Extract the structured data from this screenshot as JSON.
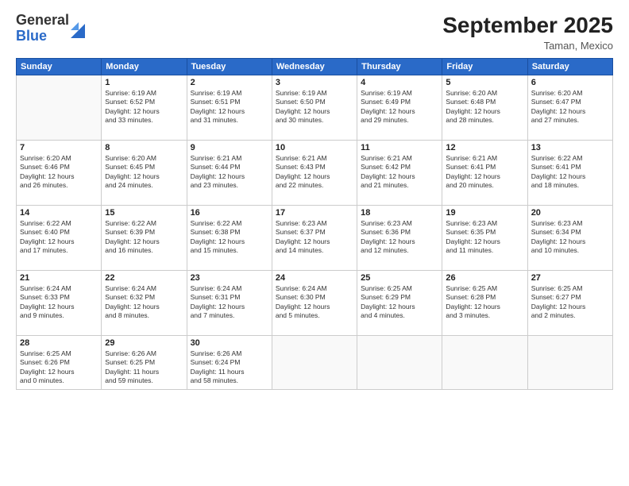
{
  "logo": {
    "general": "General",
    "blue": "Blue"
  },
  "title": "September 2025",
  "location": "Taman, Mexico",
  "days_header": [
    "Sunday",
    "Monday",
    "Tuesday",
    "Wednesday",
    "Thursday",
    "Friday",
    "Saturday"
  ],
  "weeks": [
    [
      {
        "num": "",
        "info": ""
      },
      {
        "num": "1",
        "info": "Sunrise: 6:19 AM\nSunset: 6:52 PM\nDaylight: 12 hours\nand 33 minutes."
      },
      {
        "num": "2",
        "info": "Sunrise: 6:19 AM\nSunset: 6:51 PM\nDaylight: 12 hours\nand 31 minutes."
      },
      {
        "num": "3",
        "info": "Sunrise: 6:19 AM\nSunset: 6:50 PM\nDaylight: 12 hours\nand 30 minutes."
      },
      {
        "num": "4",
        "info": "Sunrise: 6:19 AM\nSunset: 6:49 PM\nDaylight: 12 hours\nand 29 minutes."
      },
      {
        "num": "5",
        "info": "Sunrise: 6:20 AM\nSunset: 6:48 PM\nDaylight: 12 hours\nand 28 minutes."
      },
      {
        "num": "6",
        "info": "Sunrise: 6:20 AM\nSunset: 6:47 PM\nDaylight: 12 hours\nand 27 minutes."
      }
    ],
    [
      {
        "num": "7",
        "info": "Sunrise: 6:20 AM\nSunset: 6:46 PM\nDaylight: 12 hours\nand 26 minutes."
      },
      {
        "num": "8",
        "info": "Sunrise: 6:20 AM\nSunset: 6:45 PM\nDaylight: 12 hours\nand 24 minutes."
      },
      {
        "num": "9",
        "info": "Sunrise: 6:21 AM\nSunset: 6:44 PM\nDaylight: 12 hours\nand 23 minutes."
      },
      {
        "num": "10",
        "info": "Sunrise: 6:21 AM\nSunset: 6:43 PM\nDaylight: 12 hours\nand 22 minutes."
      },
      {
        "num": "11",
        "info": "Sunrise: 6:21 AM\nSunset: 6:42 PM\nDaylight: 12 hours\nand 21 minutes."
      },
      {
        "num": "12",
        "info": "Sunrise: 6:21 AM\nSunset: 6:41 PM\nDaylight: 12 hours\nand 20 minutes."
      },
      {
        "num": "13",
        "info": "Sunrise: 6:22 AM\nSunset: 6:41 PM\nDaylight: 12 hours\nand 18 minutes."
      }
    ],
    [
      {
        "num": "14",
        "info": "Sunrise: 6:22 AM\nSunset: 6:40 PM\nDaylight: 12 hours\nand 17 minutes."
      },
      {
        "num": "15",
        "info": "Sunrise: 6:22 AM\nSunset: 6:39 PM\nDaylight: 12 hours\nand 16 minutes."
      },
      {
        "num": "16",
        "info": "Sunrise: 6:22 AM\nSunset: 6:38 PM\nDaylight: 12 hours\nand 15 minutes."
      },
      {
        "num": "17",
        "info": "Sunrise: 6:23 AM\nSunset: 6:37 PM\nDaylight: 12 hours\nand 14 minutes."
      },
      {
        "num": "18",
        "info": "Sunrise: 6:23 AM\nSunset: 6:36 PM\nDaylight: 12 hours\nand 12 minutes."
      },
      {
        "num": "19",
        "info": "Sunrise: 6:23 AM\nSunset: 6:35 PM\nDaylight: 12 hours\nand 11 minutes."
      },
      {
        "num": "20",
        "info": "Sunrise: 6:23 AM\nSunset: 6:34 PM\nDaylight: 12 hours\nand 10 minutes."
      }
    ],
    [
      {
        "num": "21",
        "info": "Sunrise: 6:24 AM\nSunset: 6:33 PM\nDaylight: 12 hours\nand 9 minutes."
      },
      {
        "num": "22",
        "info": "Sunrise: 6:24 AM\nSunset: 6:32 PM\nDaylight: 12 hours\nand 8 minutes."
      },
      {
        "num": "23",
        "info": "Sunrise: 6:24 AM\nSunset: 6:31 PM\nDaylight: 12 hours\nand 7 minutes."
      },
      {
        "num": "24",
        "info": "Sunrise: 6:24 AM\nSunset: 6:30 PM\nDaylight: 12 hours\nand 5 minutes."
      },
      {
        "num": "25",
        "info": "Sunrise: 6:25 AM\nSunset: 6:29 PM\nDaylight: 12 hours\nand 4 minutes."
      },
      {
        "num": "26",
        "info": "Sunrise: 6:25 AM\nSunset: 6:28 PM\nDaylight: 12 hours\nand 3 minutes."
      },
      {
        "num": "27",
        "info": "Sunrise: 6:25 AM\nSunset: 6:27 PM\nDaylight: 12 hours\nand 2 minutes."
      }
    ],
    [
      {
        "num": "28",
        "info": "Sunrise: 6:25 AM\nSunset: 6:26 PM\nDaylight: 12 hours\nand 0 minutes."
      },
      {
        "num": "29",
        "info": "Sunrise: 6:26 AM\nSunset: 6:25 PM\nDaylight: 11 hours\nand 59 minutes."
      },
      {
        "num": "30",
        "info": "Sunrise: 6:26 AM\nSunset: 6:24 PM\nDaylight: 11 hours\nand 58 minutes."
      },
      {
        "num": "",
        "info": ""
      },
      {
        "num": "",
        "info": ""
      },
      {
        "num": "",
        "info": ""
      },
      {
        "num": "",
        "info": ""
      }
    ]
  ]
}
